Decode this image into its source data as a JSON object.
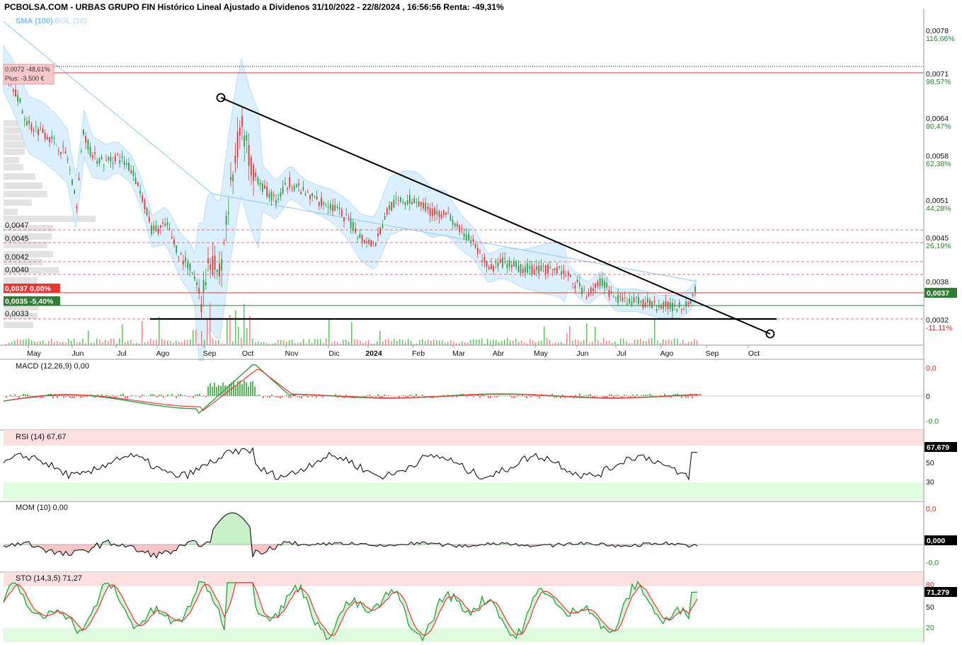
{
  "header": "PCBOLSA.COM - URBAS GRUPO FIN Histórico Lineal Ajustado a Dividenos 31/10/2022 - 22/8/2024 , 16:56:56 Renta: -49,31%",
  "legend": [
    "SMA (100)",
    "BOL (20)"
  ],
  "price_labels_left": [
    "0,0047",
    "0,0045",
    "0,0042",
    "0,0040",
    "0,0033"
  ],
  "info_box": [
    "0,0072  -48,61%",
    "Plus: -3.500 €"
  ],
  "badges": [
    {
      "text": "0,0037  0,00%",
      "color": "#e53935"
    },
    {
      "text": "0,0035  -5,40%",
      "color": "#2e7d32"
    }
  ],
  "right_axis": [
    {
      "price": "0,0078",
      "pct": "116,66%",
      "pct_color": "#2e7d32"
    },
    {
      "price": "0,0071",
      "pct": "98,57%",
      "pct_color": "#2e7d32"
    },
    {
      "price": "0,0064",
      "pct": "80,47%",
      "pct_color": "#2e7d32"
    },
    {
      "price": "0,0058",
      "pct": "62,38%",
      "pct_color": "#2e7d32"
    },
    {
      "price": "0,0051",
      "pct": "44,28%",
      "pct_color": "#2e7d32"
    },
    {
      "price": "0,0045",
      "pct": "26,19%",
      "pct_color": "#2e7d32"
    },
    {
      "price": "0,0038",
      "pct": "",
      "pct_color": ""
    },
    {
      "price": "0,0037",
      "pct": "",
      "pct_color": ""
    },
    {
      "price": "0,0032",
      "pct": "-11,11%",
      "pct_color": "#c62828"
    }
  ],
  "x_axis": [
    "May",
    "Jun",
    "Jul",
    "Ago",
    "Sep",
    "Oct",
    "Nov",
    "Dic",
    "2024",
    "Feb",
    "Mar",
    "Abr",
    "May",
    "Jun",
    "Jul",
    "Ago",
    "Sep",
    "Oct"
  ],
  "panels": {
    "macd": {
      "title": "MACD (12,26,9)",
      "value": "0,00",
      "ticks": [
        "0,0",
        "0",
        "-0,0"
      ]
    },
    "rsi": {
      "title": "RSI (14)",
      "value": "67,67",
      "badge": "67,679",
      "ticks": [
        "50",
        "30"
      ]
    },
    "mom": {
      "title": "MOM (10)",
      "value": "0,00",
      "badge": "0,000",
      "ticks": [
        "0,0",
        "-0,0"
      ]
    },
    "sto": {
      "title": "STO (14,3,5)",
      "value": "71,27",
      "badge": "71,279",
      "ticks": [
        "80",
        "50",
        "20"
      ]
    }
  },
  "chart_data": {
    "type": "line",
    "title": "PCBOLSA.COM - URBAS GRUPO FIN Histórico Lineal Ajustado a Dividenos 31/10/2022 - 22/8/2024 , 16:56:56 Renta: -49,31%",
    "x": [
      "May",
      "Jun",
      "Jul",
      "Ago",
      "Sep",
      "Oct",
      "Nov",
      "Dic",
      "2024",
      "Feb",
      "Mar",
      "Abr",
      "May",
      "Jun",
      "Jul",
      "Ago"
    ],
    "series": [
      {
        "name": "",
        "values": [
          0.0062,
          0.0056,
          0.0053,
          0.0046,
          0.0038,
          0.0061,
          0.0052,
          0.0051,
          0.0048,
          0.0051,
          0.0048,
          0.0042,
          0.004,
          0.0036,
          0.0034,
          0.0037
        ]
      }
    ],
    "ylim": [
      0.003,
      0.008
    ],
    "grid": false,
    "legend_position": "top-left"
  }
}
